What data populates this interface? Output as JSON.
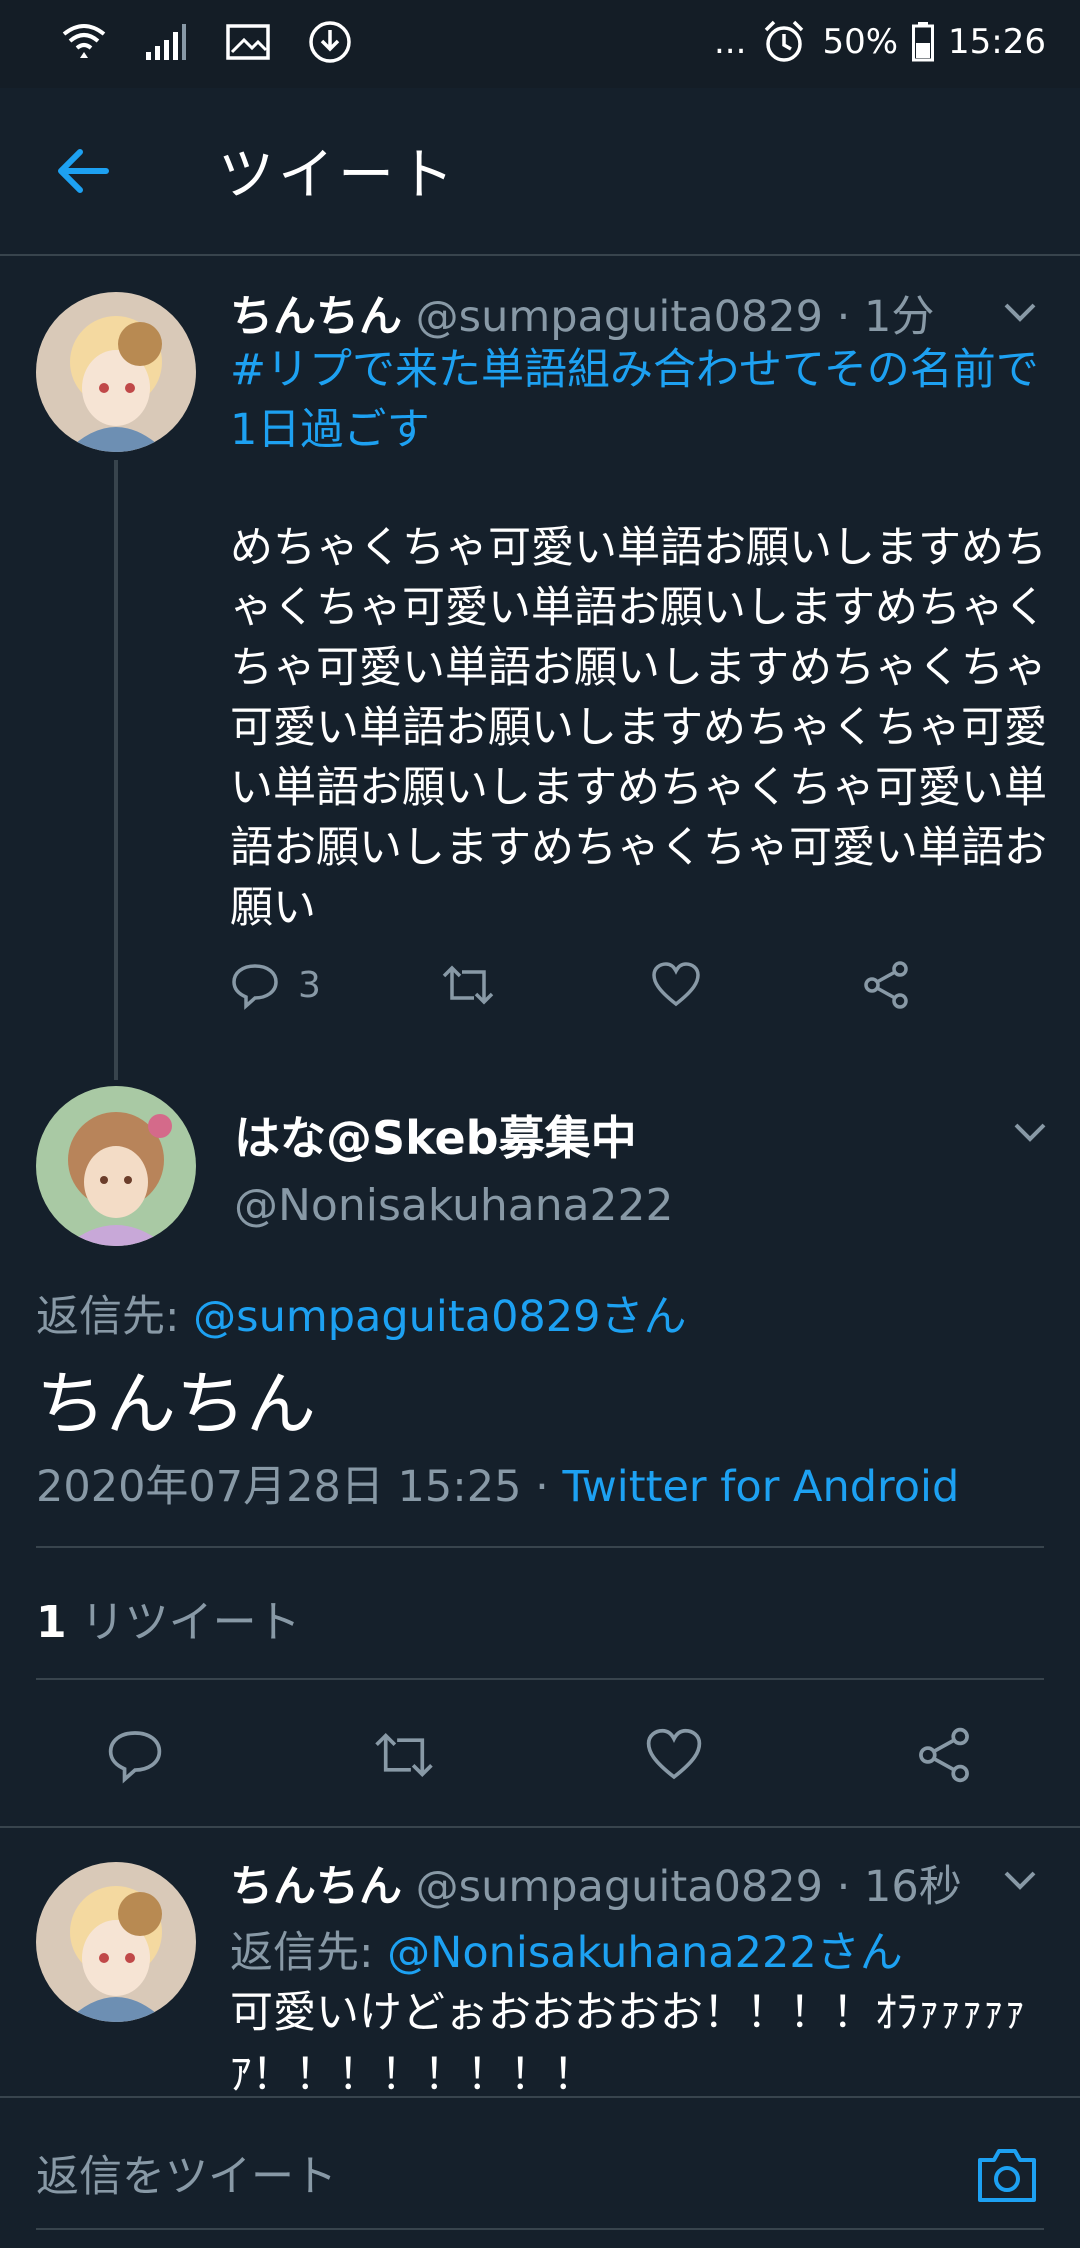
{
  "status_bar": {
    "icons_left": [
      "wifi-icon",
      "signal-icon",
      "image-icon",
      "download-icon"
    ],
    "dots": "...",
    "battery": "50%",
    "time": "15:26"
  },
  "header": {
    "title": "ツイート"
  },
  "tweet1": {
    "name": "ちんちん",
    "handle": "@sumpaguita0829",
    "time": "· 1分",
    "hashtag": "#リプで来た単語組み合わせてその名前で1日過ごす",
    "body": "めちゃくちゃ可愛い単語お願いしますめちゃくちゃ可愛い単語お願いしますめちゃくちゃ可愛い単語お願いしますめちゃくちゃ可愛い単語お願いしますめちゃくちゃ可愛い単語お願いしますめちゃくちゃ可愛い単語お願いしますめちゃくちゃ可愛い単語お願い",
    "reply_count": "3"
  },
  "tweet2": {
    "name": "はな@Skeb募集中",
    "handle": "@Nonisakuhana222",
    "reply_to_label": "返信先:",
    "reply_to_user": "@sumpaguita0829さん",
    "text": "ちんちん",
    "timestamp": "2020年07月28日 15:25",
    "separator": "·",
    "source": "Twitter for Android",
    "retweet_count": "1",
    "retweet_label": "リツイート"
  },
  "tweet3": {
    "name": "ちんちん",
    "handle": "@sumpaguita0829",
    "time": "· 16秒",
    "reply_to_label": "返信先:",
    "reply_to_user": "@Nonisakuhana222さん",
    "body": "可愛いけどぉおおおおお！！！！ｵﾗｧｧｧｧｧｱ！！！！！！！！"
  },
  "compose": {
    "placeholder": "返信をツイート"
  },
  "colors": {
    "background": "#15202b",
    "accent": "#1da1f2",
    "muted": "#8899a6",
    "divider": "#38444d"
  }
}
